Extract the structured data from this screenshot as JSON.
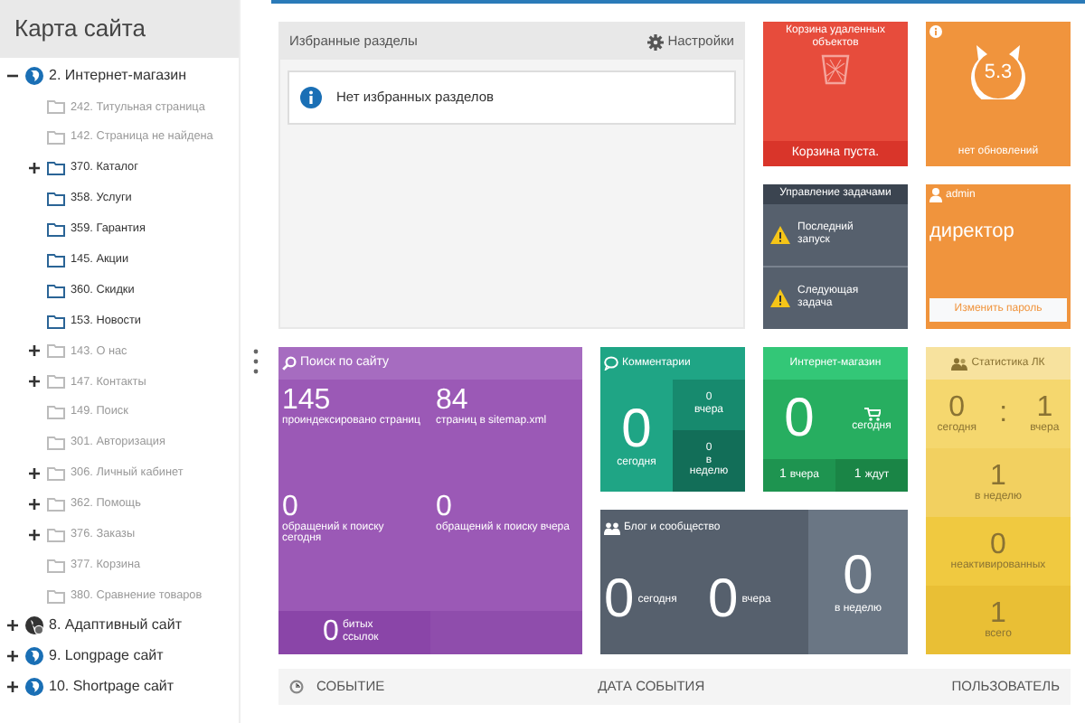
{
  "sidebar": {
    "title": "Карта сайта",
    "tree": [
      {
        "label": "2. Интернет-магазин",
        "kind": "site",
        "expanded": true,
        "children": [
          {
            "label": "242. Титульная страница",
            "expandable": false,
            "dim": true
          },
          {
            "label": "142. Страница не найдена",
            "expandable": false,
            "dim": true
          },
          {
            "label": "370. Каталог",
            "expandable": true,
            "dim": false
          },
          {
            "label": "358. Услуги",
            "expandable": false,
            "dim": false
          },
          {
            "label": "359. Гарантия",
            "expandable": false,
            "dim": false
          },
          {
            "label": "145. Акции",
            "expandable": false,
            "dim": false
          },
          {
            "label": "360. Скидки",
            "expandable": false,
            "dim": false
          },
          {
            "label": "153. Новости",
            "expandable": false,
            "dim": false
          },
          {
            "label": "143. О нас",
            "expandable": true,
            "dim": true
          },
          {
            "label": "147. Контакты",
            "expandable": true,
            "dim": true
          },
          {
            "label": "149. Поиск",
            "expandable": false,
            "dim": true
          },
          {
            "label": "301. Авторизация",
            "expandable": false,
            "dim": true
          },
          {
            "label": "306. Личный кабинет",
            "expandable": true,
            "dim": true
          },
          {
            "label": "362. Помощь",
            "expandable": true,
            "dim": true
          },
          {
            "label": "376. Заказы",
            "expandable": true,
            "dim": true
          },
          {
            "label": "377. Корзина",
            "expandable": false,
            "dim": true
          },
          {
            "label": "380. Сравнение товаров",
            "expandable": false,
            "dim": true
          }
        ]
      },
      {
        "label": "8. Адаптивный сайт",
        "kind": "adaptive",
        "expanded": false
      },
      {
        "label": "9. Longpage сайт",
        "kind": "site",
        "expanded": false
      },
      {
        "label": "10. Shortpage сайт",
        "kind": "site",
        "expanded": false
      }
    ]
  },
  "favorites": {
    "title": "Избранные разделы",
    "settings": "Настройки",
    "message": "Нет избранных разделов"
  },
  "trash": {
    "title": "Корзина удаленных объектов",
    "status": "Корзина пуста."
  },
  "update": {
    "version": "5.3",
    "status": "нет обновлений"
  },
  "tasks": {
    "title": "Управление задачами",
    "items": [
      "Последний запуск",
      "Следующая задача"
    ]
  },
  "admin": {
    "user": "admin",
    "role": "директор",
    "button": "Изменить пароль"
  },
  "search": {
    "title": "Поиск по сайту",
    "stats": [
      {
        "value": "145",
        "label": "проиндексировано страниц"
      },
      {
        "value": "84",
        "label": "страниц в sitemap.xml"
      },
      {
        "value": "0",
        "label": "обращений к поиску сегодня"
      },
      {
        "value": "0",
        "label": "обращений к поиску вчера"
      }
    ],
    "broken": {
      "value": "0",
      "label": "битых ссылок"
    }
  },
  "comments": {
    "title": "Комментарии",
    "today": {
      "value": "0",
      "label": "сегодня"
    },
    "yesterday": {
      "value": "0",
      "label": "вчера"
    },
    "week": {
      "value": "0",
      "label": "в неделю"
    }
  },
  "shop": {
    "title": "Интернет-магазин",
    "today": {
      "value": "0",
      "label": "сегодня"
    },
    "yesterday": {
      "value": "1",
      "label": "вчера"
    },
    "waiting": {
      "value": "1",
      "label": "ждут"
    }
  },
  "blog": {
    "title": "Блог и сообщество",
    "stats": [
      {
        "value": "0",
        "label": "сегодня"
      },
      {
        "value": "0",
        "label": "вчера"
      },
      {
        "value": "0",
        "label": "в неделю"
      }
    ]
  },
  "user_stats": {
    "title": "Статистика ЛК",
    "today": {
      "value": "0",
      "label": "сегодня"
    },
    "separator": ":",
    "yesterday": {
      "value": "1",
      "label": "вчера"
    },
    "rows": [
      {
        "value": "1",
        "label": "в неделю"
      },
      {
        "value": "0",
        "label": "неактивированных"
      },
      {
        "value": "1",
        "label": "всего"
      }
    ]
  },
  "events_table": {
    "columns": [
      "СОБЫТИЕ",
      "ДАТА СОБЫТИЯ",
      "ПОЛЬЗОВАТЕЛЬ"
    ]
  }
}
